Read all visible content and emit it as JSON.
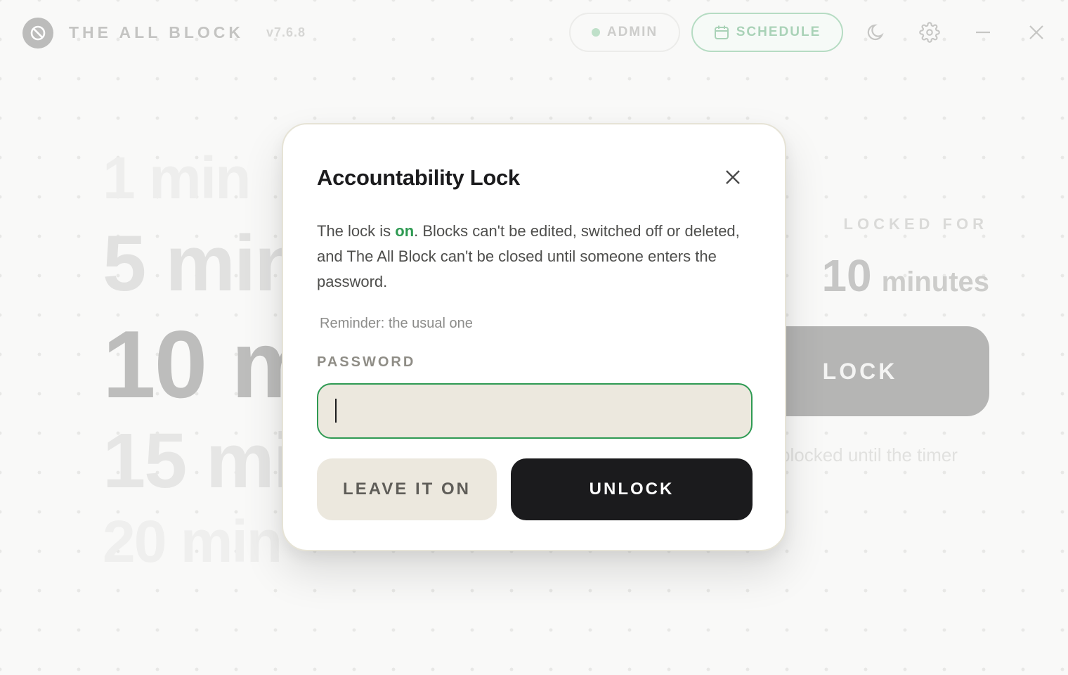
{
  "titlebar": {
    "app_name": "THE ALL BLOCK",
    "version": "v7.6.8",
    "admin_label": "ADMIN",
    "schedule_label": "SCHEDULE",
    "icons": [
      "block-icon",
      "calendar-icon",
      "moon-icon",
      "gear-icon",
      "minimize-icon",
      "close-icon"
    ]
  },
  "durations": [
    "1 min",
    "5 min",
    "10 min",
    "15 min",
    "20 min"
  ],
  "selected_duration": "10 min",
  "locked": {
    "label": "LOCKED FOR",
    "value": "10",
    "unit": "minutes",
    "button_label": "LOCK",
    "hint": "blocked until the timer"
  },
  "modal": {
    "title": "Accountability Lock",
    "body_prefix": "The lock is ",
    "body_status": "on",
    "body_suffix": ". Blocks can't be edited, switched off or deleted, and The All Block can't be closed until someone enters the password.",
    "reminder": "Reminder: the usual one",
    "password_label": "PASSWORD",
    "password_value": "",
    "leave_button": "LEAVE IT ON",
    "unlock_button": "UNLOCK"
  },
  "colors": {
    "accent_green": "#2e9a52",
    "dark": "#1b1b1d",
    "input_bg": "#ece8de"
  }
}
